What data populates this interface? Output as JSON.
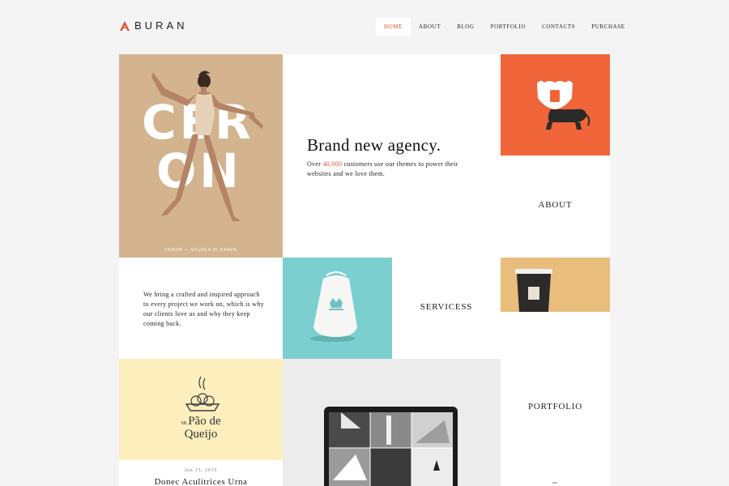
{
  "brand": {
    "name": "BURAN",
    "accent_color": "#e04b2d"
  },
  "nav": {
    "items": [
      {
        "label": "HOME",
        "active": true
      },
      {
        "label": "ABOUT",
        "active": false
      },
      {
        "label": "BLOG",
        "active": false
      },
      {
        "label": "PORTFOLIO",
        "active": false
      },
      {
        "label": "CONTACTS",
        "active": false
      },
      {
        "label": "PURCHASE",
        "active": false
      }
    ]
  },
  "ceron": {
    "line1": "CER",
    "line2": "ON",
    "caption": "CERON — SCUOLA DI DANZA"
  },
  "hero": {
    "title": "Brand new agency.",
    "text_before": "Over ",
    "highlight": "40,000",
    "text_after": " customers use our themes to power their websites and we love them."
  },
  "lion": {
    "icon": "lion-icon"
  },
  "about": {
    "label": "ABOUT"
  },
  "crafted": {
    "text": "We bring a crafted and inspired approach to every project we work on, which is why our clients love us and why they keep coming back."
  },
  "bag": {
    "icon": "tote-bag-icon"
  },
  "services": {
    "label": "SERVICESS"
  },
  "coffee": {
    "icon": "coffee-cup-icon"
  },
  "pao": {
    "prefix": "SR.",
    "line1": "Pão de",
    "line2": "Queijo",
    "icon": "bread-basket-icon"
  },
  "post": {
    "date": "Jun 15, 2015",
    "title": "Donec Aculitrices Urna"
  },
  "laptop": {
    "icon": "laptop-icon"
  },
  "portfolio": {
    "label": "PORTFOLIO"
  },
  "colors": {
    "ceron_bg": "#d3b48f",
    "lion_bg": "#f0653a",
    "bag_bg": "#7ccfcf",
    "coffee_bg": "#e9bd7c",
    "pao_bg": "#fdefbd"
  }
}
